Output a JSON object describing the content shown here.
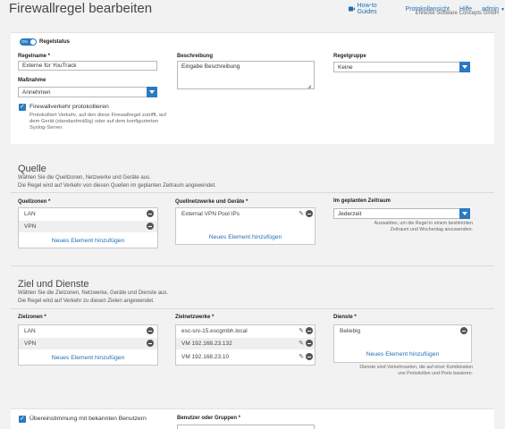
{
  "page": {
    "title": "Firewallregel bearbeiten"
  },
  "header": {
    "howto": "How-to Guides",
    "log": "Protokollansicht",
    "help": "Hilfe",
    "admin": "admin",
    "company": "Ehrecke Software Concepts GmbH"
  },
  "general": {
    "toggle_label": "ON",
    "status_label": "Regelstatus",
    "name_label": "Regelname *",
    "name_value": "Externe für YouTrack",
    "action_label": "Maßnahme",
    "action_value": "Annehmen",
    "log_label": "Firewallverkehr protokollieren",
    "log_help": [
      "Protokolliert Verkehr, auf den diese Firewallregel zutrifft, auf",
      "dem Gerät (standardmäßig) oder auf dem konfigurierten",
      "Syslog-Server."
    ],
    "desc_label": "Beschreibung",
    "desc_placeholder": "Eingabe Beschreibung",
    "group_label": "Regelgruppe",
    "group_value": "Keine"
  },
  "source": {
    "title": "Quelle",
    "sub1": "Wählen Sie die Quellzonen, Netzwerke und Geräte aus.",
    "sub2": "Die Regel wird auf Verkehr von diesen Quellen im geplanten Zeitraum angewendet.",
    "zones_label": "Quellzonen *",
    "zones": [
      "LAN",
      "VPN"
    ],
    "add": "Neues Element hinzufügen",
    "networks_label": "Quellnetzwerke und Geräte *",
    "networks": [
      "External VPN Pool IPs"
    ],
    "schedule_label": "Im geplanten Zeitraum",
    "schedule_value": "Jederzeit",
    "schedule_help": [
      "Auswahlen, um die Regel in einem bestimmten",
      "Zeitraum und Wochentag anzuwenden."
    ]
  },
  "dest": {
    "title": "Ziel und Dienste",
    "sub1": "Wählen Sie die Zielzonen, Netzwerke, Geräte und Dienste aus.",
    "sub2": "Die Regel wird auf Verkehr zu diesen Zielen angewendet.",
    "zones_label": "Zielzonen *",
    "zones": [
      "LAN",
      "VPN"
    ],
    "networks_label": "Zielnetzwerke *",
    "networks": [
      "esc-srv-15.escgmbh.local",
      "VM 192.168.23.132",
      "VM 192.168.23.10"
    ],
    "services_label": "Dienste *",
    "services": [
      "Beliebig"
    ],
    "add": "Neues Element hinzufügen",
    "services_help": [
      "Dienste sind Verkehrsarten, die auf einer Kombination",
      "von Protokollen und Ports basieren."
    ]
  },
  "bottom": {
    "match_label": "Übereinstimmung mit bekannten Benutzern",
    "users_label": "Benutzer oder Gruppen *"
  }
}
